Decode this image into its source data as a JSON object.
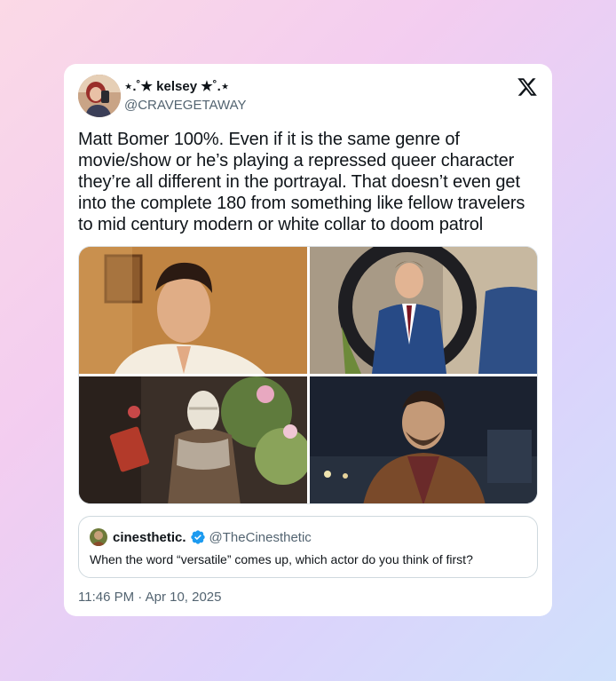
{
  "author": {
    "display_name": "⋆.˚★ kelsey ★˚.⋆",
    "handle": "@CRAVEGETAWAY",
    "avatar_icon": "user-avatar"
  },
  "tweet": {
    "text": "Matt Bomer 100%. Even if it is the same genre of movie/show or he’s playing a repressed queer character they’re all different in the portrayal. That doesn’t even get into the complete 180 from something like fellow travelers to mid century modern or white collar to doom patrol",
    "timestamp": "11:46 PM · Apr 10, 2025",
    "media": [
      "photo-1",
      "photo-2",
      "photo-3",
      "photo-4"
    ]
  },
  "quote": {
    "display_name": "cinesthetic.",
    "handle": "@TheCinesthetic",
    "text": "When the word “versatile” comes up, which actor do you think of first?",
    "verified": true
  },
  "colors": {
    "text_primary": "#0f1419",
    "text_secondary": "#536471",
    "verified_blue": "#1d9bf0",
    "card_background": "#ffffff"
  },
  "icons": {
    "platform_logo": "x-logo-icon",
    "verified": "verified-badge-icon"
  }
}
